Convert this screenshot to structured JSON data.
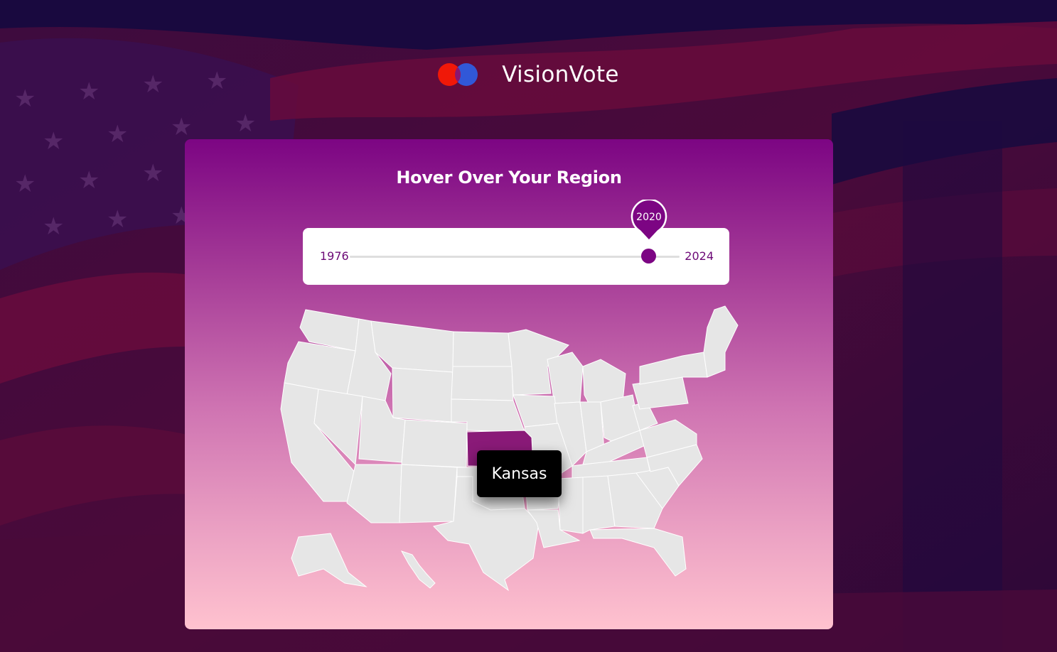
{
  "app": {
    "name": "VisionVote"
  },
  "colors": {
    "brand_purple": "#7c0583",
    "logo_red": "#f01808",
    "logo_blue": "#3158d8",
    "highlight_state": "#8a1a78"
  },
  "icons": {
    "logo": "overlapping-circles-logo",
    "pin": "map-pin-marker"
  },
  "map_card": {
    "title": "Hover Over Your Region",
    "year_slider": {
      "min_label": "1976",
      "max_label": "2024",
      "selected_label": "2020",
      "selected_value": 2020,
      "min": 1976,
      "max": 2024
    },
    "hovered_state": {
      "name": "Kansas"
    }
  }
}
